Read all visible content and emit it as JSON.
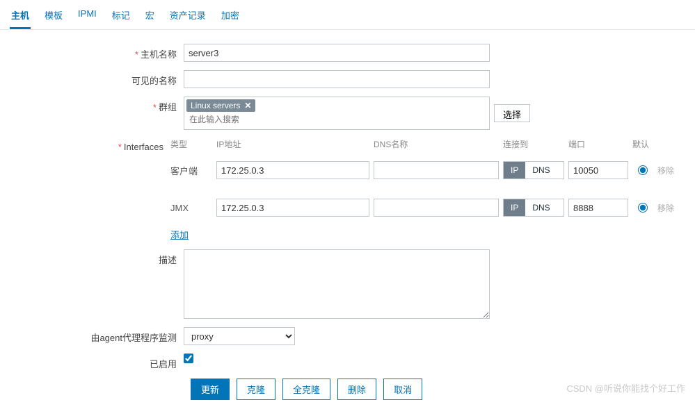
{
  "tabs": {
    "host": "主机",
    "templates": "模板",
    "ipmi": "IPMI",
    "tags": "标记",
    "macros": "宏",
    "inventory": "资产记录",
    "encryption": "加密"
  },
  "labels": {
    "host_name": "主机名称",
    "visible_name": "可见的名称",
    "groups": "群组",
    "interfaces": "Interfaces",
    "description": "描述",
    "monitored_by": "由agent代理程序监测",
    "enabled": "已启用"
  },
  "values": {
    "host_name": "server3",
    "visible_name": "",
    "proxy": "proxy"
  },
  "groups": {
    "tag_label": "Linux servers",
    "search_placeholder": "在此输入搜索",
    "select_button": "选择"
  },
  "interfaces": {
    "headers": {
      "type": "类型",
      "ip": "IP地址",
      "dns": "DNS名称",
      "connect_to": "连接到",
      "port": "端口",
      "default": "默认"
    },
    "rows": [
      {
        "type": "客户端",
        "ip": "172.25.0.3",
        "dns": "",
        "connect": "IP",
        "port": "10050"
      },
      {
        "type": "JMX",
        "ip": "172.25.0.3",
        "dns": "",
        "connect": "IP",
        "port": "8888"
      }
    ],
    "toggle_ip": "IP",
    "toggle_dns": "DNS",
    "remove": "移除",
    "add": "添加"
  },
  "buttons": {
    "update": "更新",
    "clone": "克隆",
    "full_clone": "全克隆",
    "delete": "删除",
    "cancel": "取消"
  },
  "watermark": "CSDN @听说你能找个好工作"
}
